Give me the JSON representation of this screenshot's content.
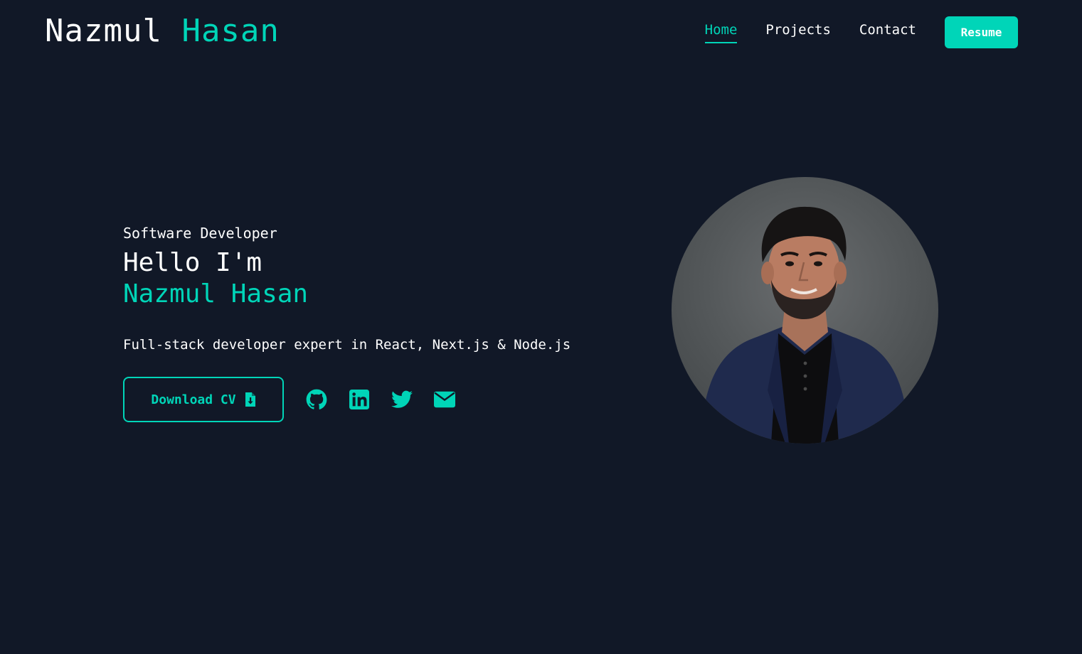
{
  "header": {
    "logo_first": "Nazmul",
    "logo_last": "Hasan",
    "nav": [
      {
        "label": "Home",
        "active": true
      },
      {
        "label": "Projects",
        "active": false
      },
      {
        "label": "Contact",
        "active": false
      }
    ],
    "resume_label": "Resume"
  },
  "hero": {
    "role": "Software Developer",
    "greeting": "Hello I'm",
    "name": "Nazmul Hasan",
    "tagline": "Full-stack developer expert in React, Next.js & Node.js",
    "download_label": "Download CV",
    "download_icon": "file-download-icon",
    "social_icons": [
      "github-icon",
      "linkedin-icon",
      "twitter-icon",
      "email-icon"
    ]
  },
  "colors": {
    "background": "#111827",
    "accent": "#00d5b8",
    "text": "#ffffff"
  }
}
